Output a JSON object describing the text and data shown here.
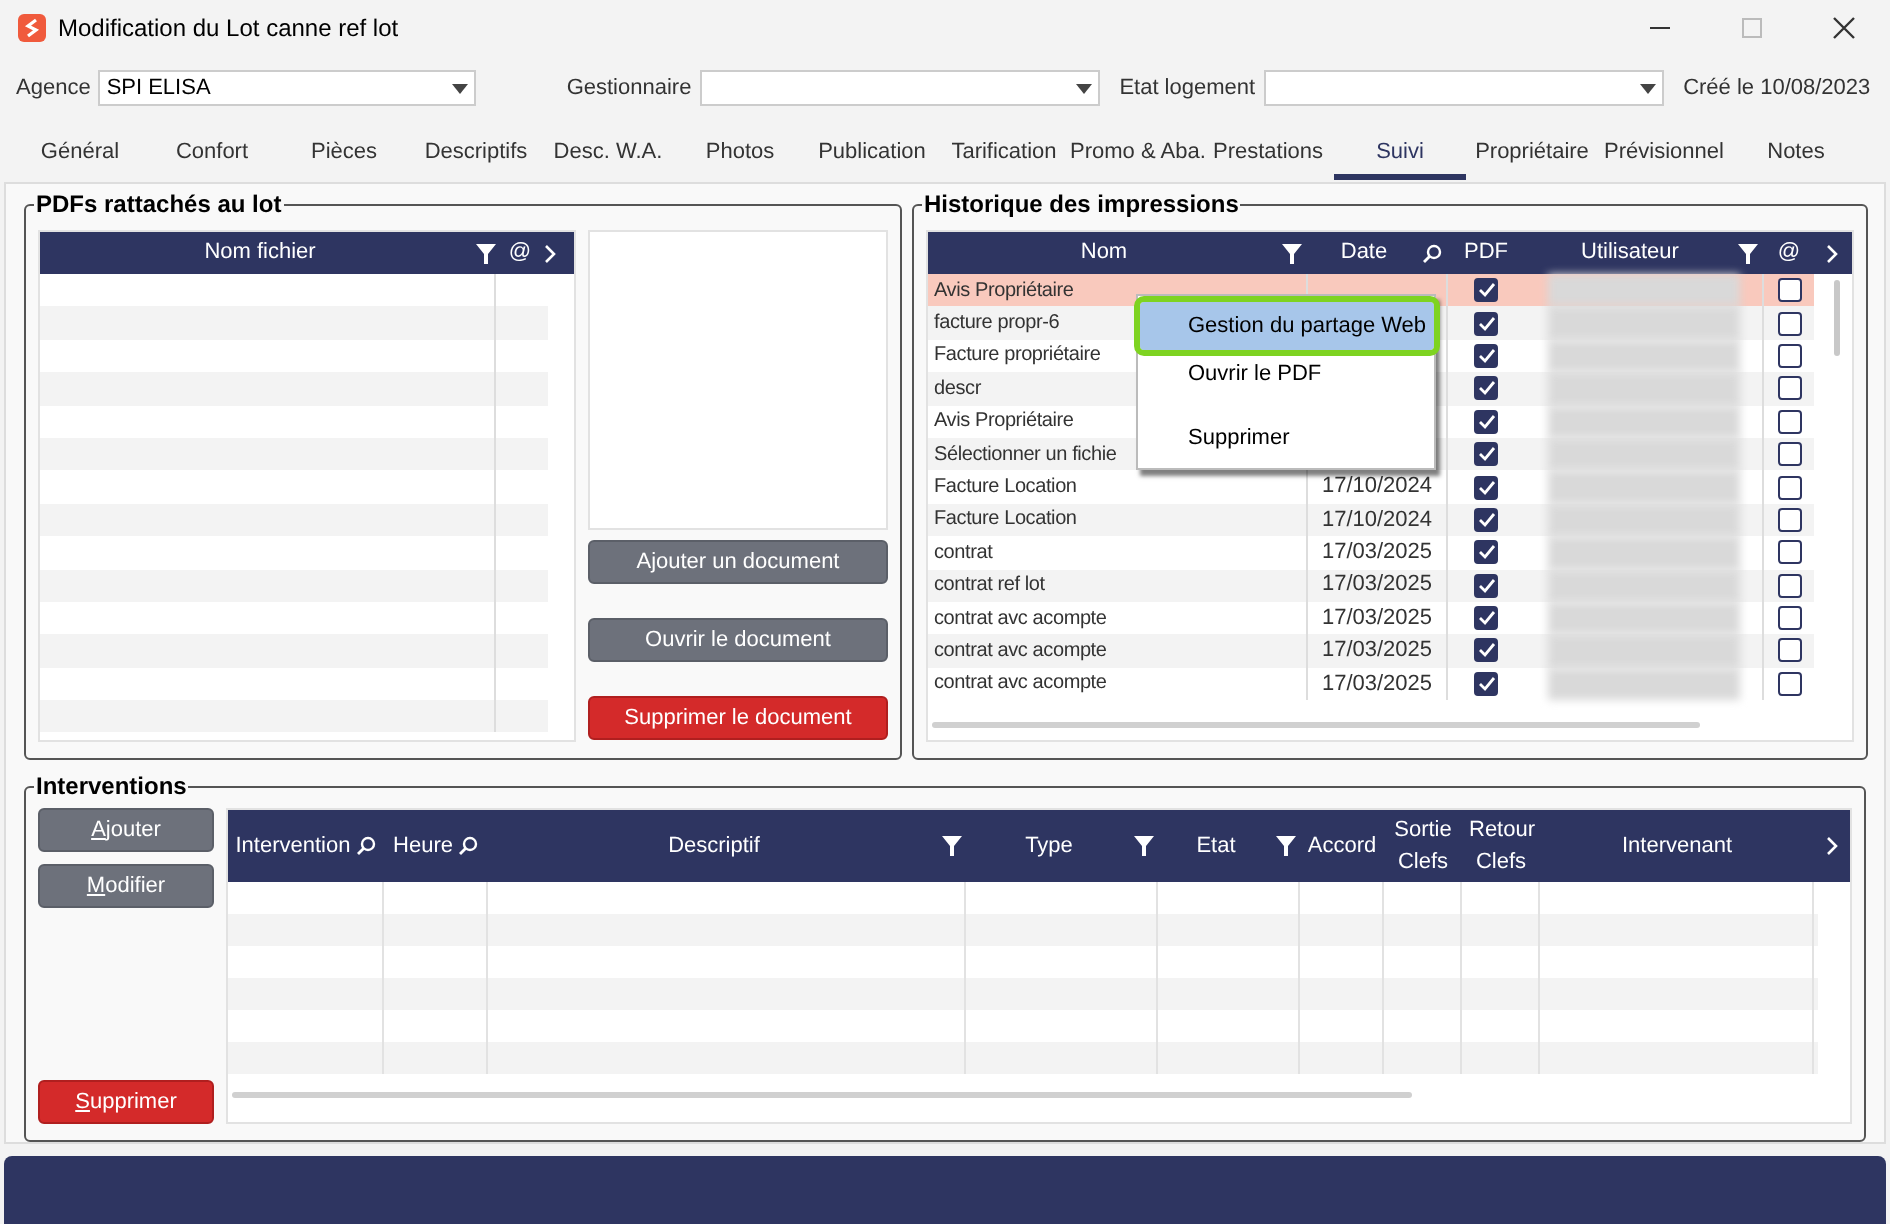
{
  "window": {
    "title": "Modification du Lot canne ref lot"
  },
  "filters": [
    {
      "label": "Agence",
      "value": "SPI ELISA"
    },
    {
      "label": "Gestionnaire"
    },
    {
      "label": "Etat logement"
    }
  ],
  "created": "Créé le 10/08/2023",
  "tabs": [
    {
      "label": "Général",
      "selected": false
    },
    {
      "label": "Confort",
      "selected": false
    },
    {
      "label": "Pièces",
      "selected": false
    },
    {
      "label": "Descriptifs",
      "selected": false
    },
    {
      "label": "Desc. W.A.",
      "selected": false
    },
    {
      "label": "Photos",
      "selected": false
    },
    {
      "label": "Publication",
      "selected": false
    },
    {
      "label": "Tarification",
      "selected": false
    },
    {
      "label": "Promo & Aba.",
      "selected": false
    },
    {
      "label": "Prestations",
      "selected": false
    },
    {
      "label": "Suivi",
      "selected": true
    },
    {
      "label": "Propriétaire",
      "selected": false
    },
    {
      "label": "Prévisionnel",
      "selected": false
    },
    {
      "label": "Notes",
      "selected": false
    }
  ],
  "pdf_panel": {
    "title": "PDFs rattachés au lot",
    "columns": [
      {
        "label": "Nom fichier",
        "kind": "filter"
      },
      {
        "label": "@",
        "kind": "plain"
      }
    ],
    "buttons": [
      {
        "label": "Ajouter un document",
        "kind": "secondary"
      },
      {
        "label": "Ouvrir le document",
        "kind": "secondary"
      },
      {
        "label": "Supprimer le document",
        "kind": "danger"
      }
    ]
  },
  "history": {
    "title": "Historique des impressions",
    "columns": [
      {
        "label": "Nom",
        "kind": "filter"
      },
      {
        "label": "Date",
        "kind": "search"
      },
      {
        "label": "PDF",
        "kind": "plain"
      },
      {
        "label": "Utilisateur",
        "kind": "filter"
      },
      {
        "label": "@",
        "kind": "plain"
      }
    ],
    "rows": [
      {
        "name": "Avis Propriétaire",
        "pdf": true,
        "web": false,
        "selected": true
      },
      {
        "name": "facture propr-6",
        "pdf": true,
        "web": false,
        "selected": false
      },
      {
        "name": "Facture propriétaire",
        "pdf": true,
        "web": false,
        "selected": false
      },
      {
        "name": "descr",
        "pdf": true,
        "web": false,
        "selected": false
      },
      {
        "name": "Avis Propriétaire",
        "pdf": true,
        "web": false,
        "selected": false
      },
      {
        "name": "Sélectionner un fichie",
        "pdf": true,
        "web": false,
        "selected": false
      },
      {
        "name": "Facture Location",
        "date": "17/10/2024",
        "pdf": true,
        "web": false,
        "selected": false
      },
      {
        "name": "Facture Location",
        "date": "17/10/2024",
        "pdf": true,
        "web": false,
        "selected": false
      },
      {
        "name": "contrat",
        "date": "17/03/2025",
        "pdf": true,
        "web": false,
        "selected": false
      },
      {
        "name": "contrat ref lot",
        "date": "17/03/2025",
        "pdf": true,
        "web": false,
        "selected": false
      },
      {
        "name": "contrat avc acompte",
        "date": "17/03/2025",
        "pdf": true,
        "web": false,
        "selected": false
      },
      {
        "name": "contrat avc acompte",
        "date": "17/03/2025",
        "pdf": true,
        "web": false,
        "selected": false
      },
      {
        "name": "contrat avc acompte",
        "date": "17/03/2025",
        "pdf": true,
        "web": false,
        "selected": false
      }
    ]
  },
  "context_menu": [
    {
      "label": "Gestion du partage Web",
      "selected": true
    },
    {
      "label": "Ouvrir le PDF",
      "selected": false
    },
    {
      "label": "Supprimer",
      "selected": false
    }
  ],
  "interventions": {
    "title": "Interventions",
    "buttons": [
      {
        "label": "Ajouter",
        "kind": "secondary"
      },
      {
        "label": "Modifier",
        "kind": "secondary"
      },
      {
        "label": "Supprimer",
        "kind": "danger"
      }
    ],
    "columns": [
      {
        "label": "Intervention",
        "kind": "search"
      },
      {
        "label": "Heure",
        "kind": "search"
      },
      {
        "label": "Descriptif",
        "kind": "filter"
      },
      {
        "label": "Type",
        "kind": "filter"
      },
      {
        "label": "Etat",
        "kind": "filter"
      },
      {
        "label": "Accord",
        "kind": "plain"
      },
      {
        "label": "Sortie Clefs",
        "kind": "plain"
      },
      {
        "label": "Retour Clefs",
        "kind": "plain"
      },
      {
        "label": "Intervenant",
        "kind": "plain"
      }
    ]
  }
}
